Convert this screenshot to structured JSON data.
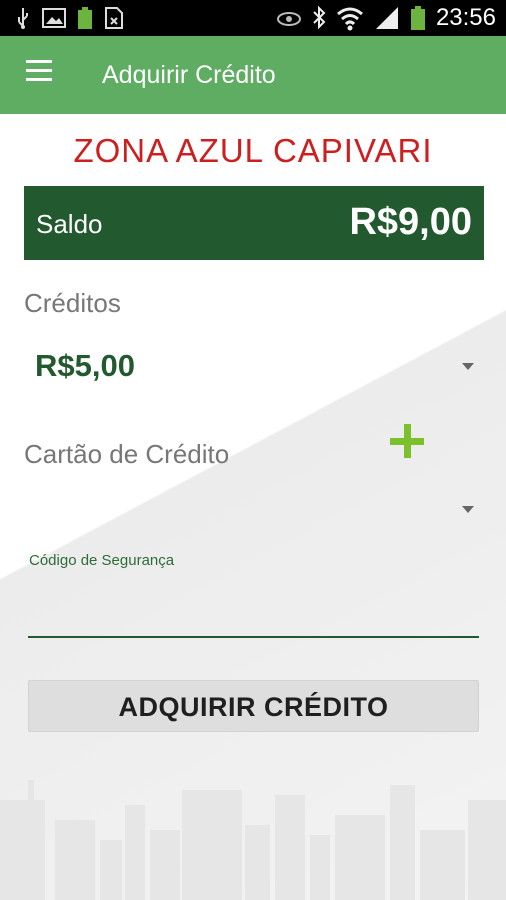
{
  "status_bar": {
    "time": "23:56",
    "left_icons": [
      "usb-icon",
      "image-icon",
      "battery-saver-icon",
      "sim-icon"
    ],
    "right_icons": [
      "eye-icon",
      "bluetooth-icon",
      "wifi-icon",
      "signal-icon",
      "battery-icon"
    ]
  },
  "app_bar": {
    "title": "Adquirir Crédito",
    "menu_icon": "hamburger-menu-icon"
  },
  "brand": "ZONA AZUL CAPIVARI",
  "balance": {
    "label": "Saldo",
    "value": "R$9,00"
  },
  "credits": {
    "label": "Créditos",
    "selected": "R$5,00"
  },
  "card": {
    "label": "Cartão de Crédito",
    "selected": "",
    "add_icon": "plus-icon"
  },
  "security": {
    "label": "Código de Segurança",
    "value": ""
  },
  "action": {
    "buy_label": "ADQUIRIR CRÉDITO"
  },
  "colors": {
    "app_bar": "#5fad62",
    "brand_red": "#cc1f1f",
    "balance_bg": "#23592f",
    "accent_green": "#7cc12c"
  }
}
